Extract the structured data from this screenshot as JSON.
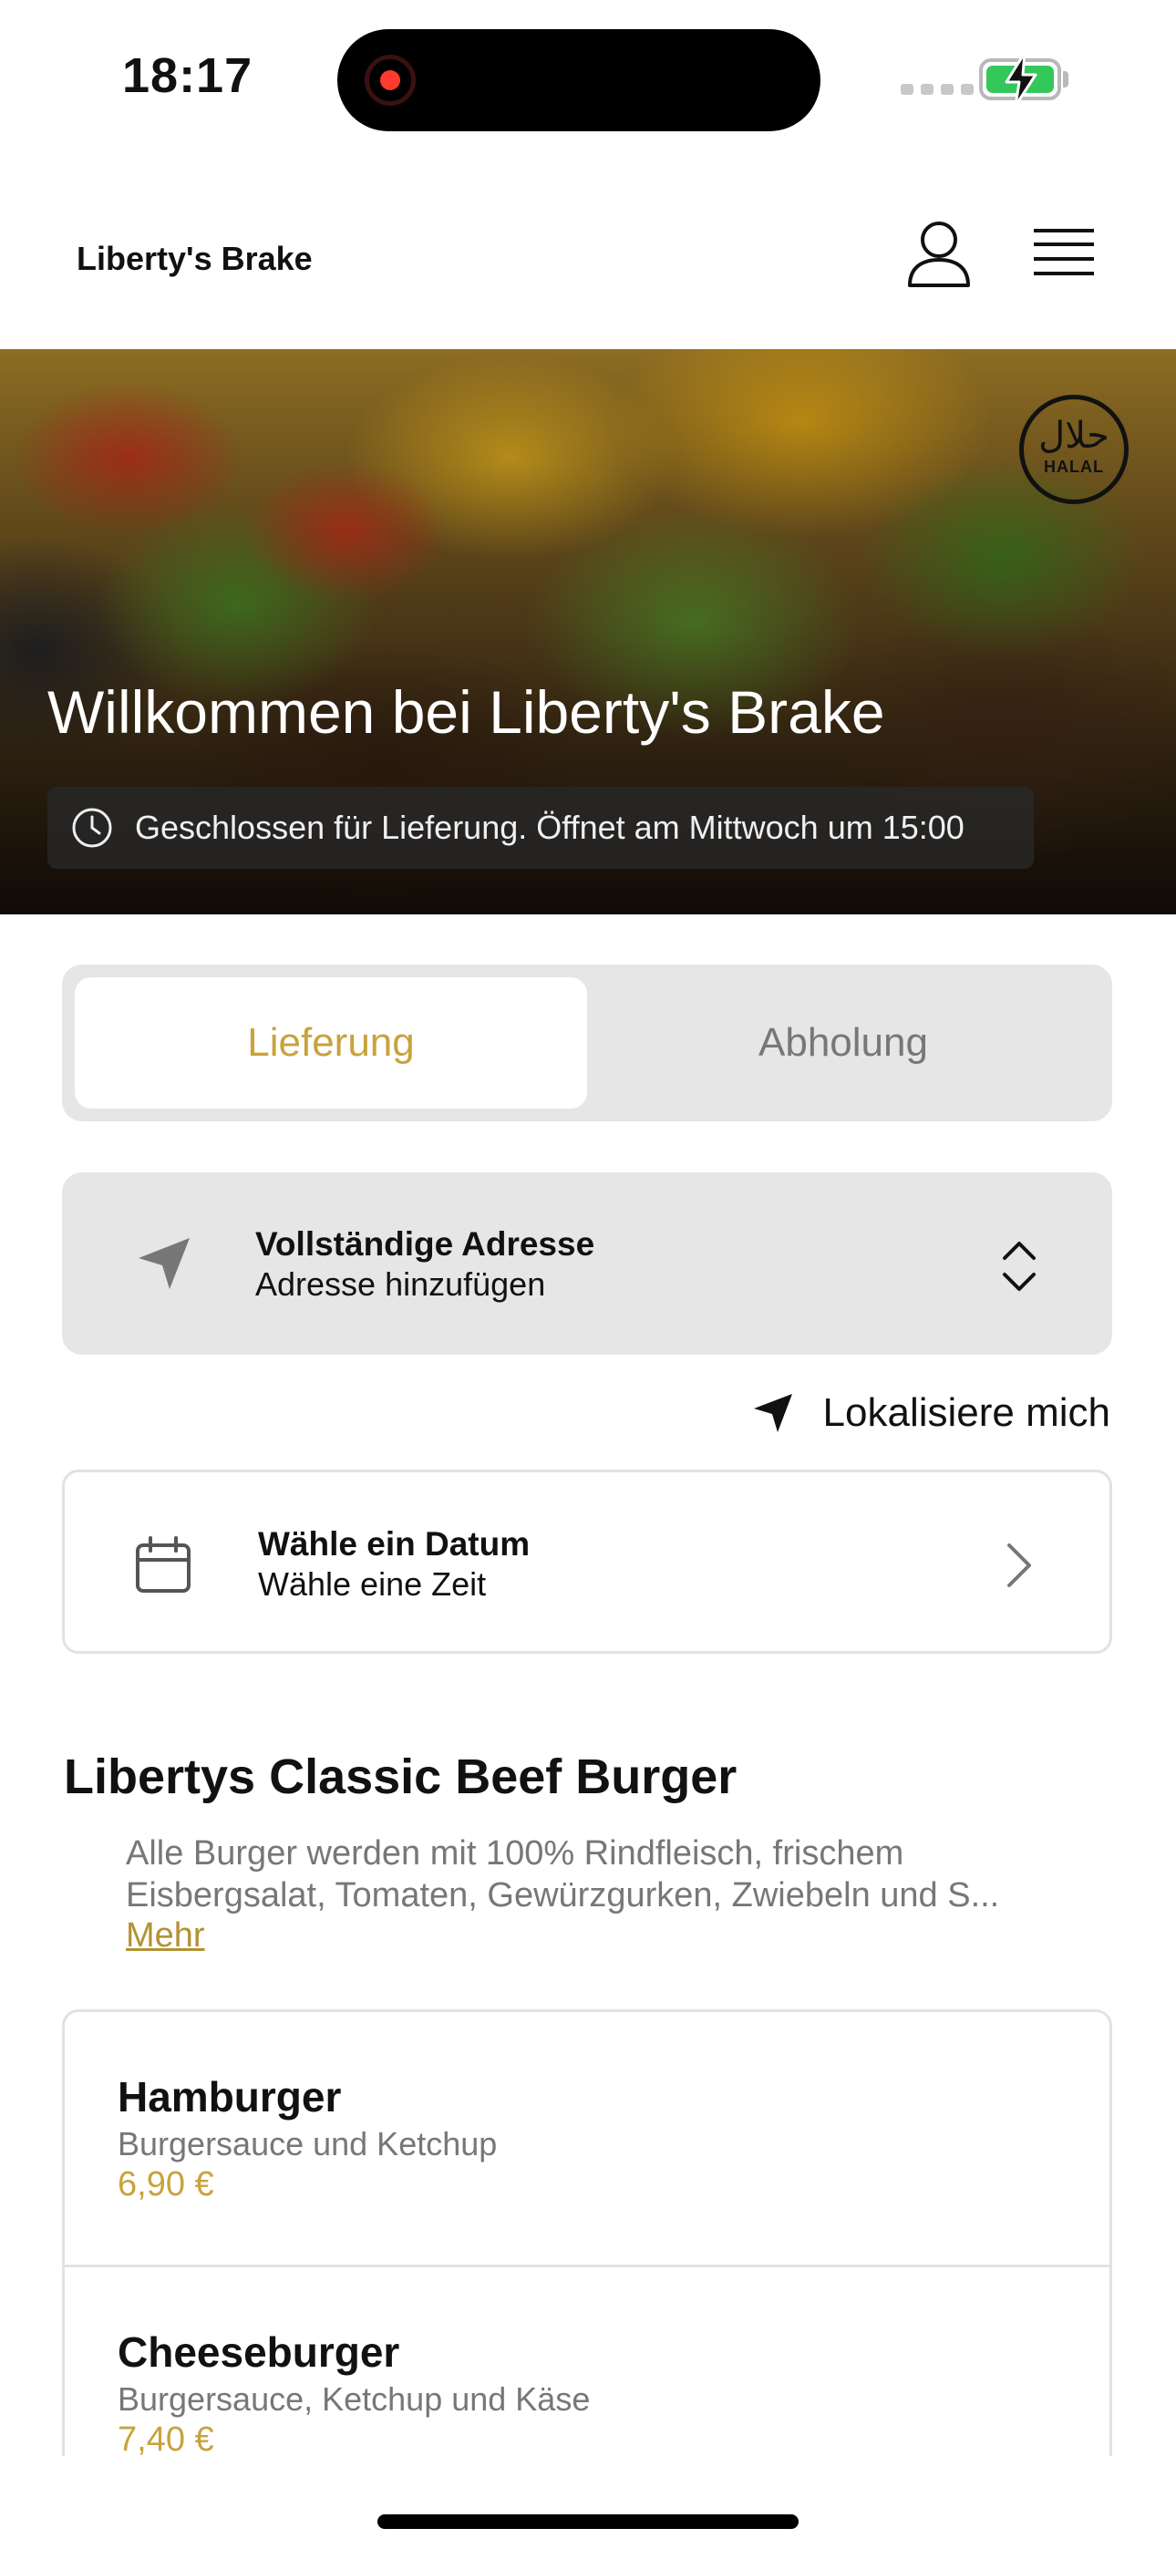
{
  "status_bar": {
    "time": "18:17"
  },
  "header": {
    "brand": "Liberty's Brake",
    "profile_icon": "user-icon",
    "menu_icon": "hamburger-menu-icon"
  },
  "hero": {
    "title": "Willkommen bei Liberty's Brake",
    "status": "Geschlossen für Lieferung. Öffnet am Mittwoch um 15:00",
    "badge_script": "حلال",
    "badge_text": "HALAL"
  },
  "mode_toggle": {
    "options": [
      "Lieferung",
      "Abholung"
    ],
    "selected": "Lieferung"
  },
  "address": {
    "title": "Vollständige Adresse",
    "subtitle": "Adresse hinzufügen"
  },
  "locate": {
    "label": "Lokalisiere mich"
  },
  "date_picker": {
    "title": "Wähle ein Datum",
    "subtitle": "Wähle eine Zeit"
  },
  "menu_section": {
    "title": "Libertys Classic Beef Burger",
    "description": "Alle Burger werden mit 100% Rindfleisch, frischem Eisbergsalat, Tomaten, Gewürzgurken, Zwiebeln und S...",
    "more_label": "Mehr",
    "items": [
      {
        "name": "Hamburger",
        "description": "Burgersauce und Ketchup",
        "price": "6,90 €"
      },
      {
        "name": "Cheeseburger",
        "description": "Burgersauce, Ketchup und Käse",
        "price": "7,40 €"
      }
    ]
  },
  "colors": {
    "accent": "#c8a33c",
    "link": "#b39233",
    "card_grey": "#e6e6e6",
    "muted_text": "#777777"
  }
}
